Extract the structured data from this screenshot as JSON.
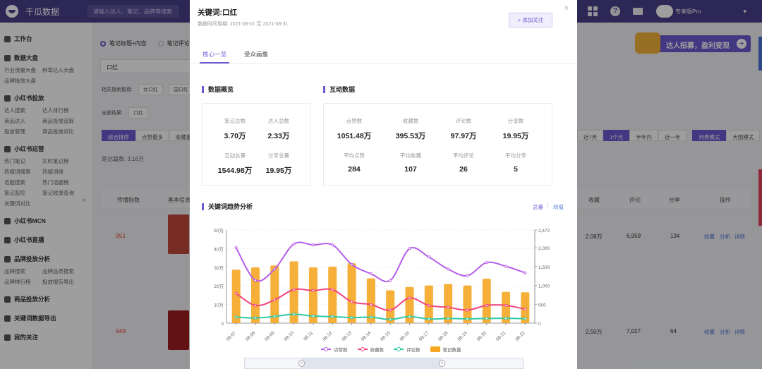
{
  "app": {
    "name": "千瓜数据",
    "search_placeholder": "请输入达人、笔记、品牌等搜索",
    "version": "专享版Pro"
  },
  "sidebar": {
    "sections": [
      {
        "title": "工作台",
        "rows": []
      },
      {
        "title": "数据大盘",
        "rows": [
          [
            "行业流量大盘",
            "种草达人大盘"
          ],
          [
            "品牌投放大盘",
            ""
          ]
        ]
      },
      {
        "title": "小红书投放",
        "rows": [
          [
            "达人搜索",
            "达人排行榜"
          ],
          [
            "商品达人",
            "商品投放追踪"
          ],
          [
            "投放管理",
            "商品投放对比"
          ]
        ]
      },
      {
        "title": "小红书运营",
        "rows": [
          [
            "热门笔记",
            "实时笔记榜"
          ],
          [
            "热搜词搜索",
            "热搜词榜"
          ],
          [
            "话题搜索",
            "热门话题榜"
          ],
          [
            "笔记监控",
            "笔记收录查询"
          ],
          [
            "关键词对比",
            ""
          ]
        ]
      },
      {
        "title": "小红书MCN",
        "rows": []
      },
      {
        "title": "小红书直播",
        "rows": []
      },
      {
        "title": "品牌投放分析",
        "rows": [
          [
            "品牌搜索",
            "品牌品类搜索"
          ],
          [
            "品牌排行榜",
            "投放报告导出"
          ]
        ]
      },
      {
        "title": "商品投放分析",
        "rows": []
      },
      {
        "title": "关键词数据导出",
        "rows": []
      },
      {
        "title": "我的关注",
        "rows": []
      }
    ]
  },
  "page": {
    "radio1": "笔记标题+内容",
    "radio2": "笔记评论",
    "keyword_value": "口红",
    "filter_label": "相关搜索推荐:",
    "chips": [
      "女口红",
      "国口红",
      "口红"
    ],
    "result_label": "全部结果:",
    "tabs": [
      "综合排序",
      "点赞最多",
      "收藏最多"
    ],
    "total": "笔记篇数:  3.16万",
    "range_tabs": [
      "近7天",
      "1个月",
      "半年内",
      "近一年"
    ],
    "mode_tabs": [
      "列表模式",
      "大图模式"
    ],
    "table_headers": [
      "传播指数",
      "基本信息",
      "收藏",
      "评论",
      "分享",
      "操作"
    ],
    "rows": [
      {
        "index": "951",
        "collect": "2.08万",
        "comment": "6,959",
        "share": "134"
      },
      {
        "index": "949",
        "collect": "2.50万",
        "comment": "7,027",
        "share": "64"
      }
    ],
    "actions": [
      "收藏",
      "分析",
      "详情"
    ],
    "banner": "达人招募，盈利变现"
  },
  "modal": {
    "title": "关键词:口红",
    "subtitle": "数据时间周期: 2021-08-01 至 2021-08-31",
    "follow_btn": "+ 添加关注",
    "close": "×",
    "tabs": [
      "核心一览",
      "受众画像"
    ],
    "overview_title": "数据概览",
    "overview": [
      {
        "label": "笔记总数",
        "value": "3.70万"
      },
      {
        "label": "达人总数",
        "value": "2.33万"
      },
      {
        "label": "互动总量",
        "value": "1544.98万"
      },
      {
        "label": "分享总量",
        "value": "19.95万"
      }
    ],
    "interaction_title": "互动数据",
    "interaction": [
      {
        "label": "点赞数",
        "value": "1051.48万"
      },
      {
        "label": "收藏数",
        "value": "395.53万"
      },
      {
        "label": "评论数",
        "value": "97.97万"
      },
      {
        "label": "分享数",
        "value": "19.95万"
      },
      {
        "label": "平均点赞",
        "value": "284"
      },
      {
        "label": "平均收藏",
        "value": "107"
      },
      {
        "label": "平均评论",
        "value": "26"
      },
      {
        "label": "平均分享",
        "value": "5"
      }
    ],
    "trend_title": "关键词趋势分析",
    "toggle": [
      "总量",
      "均值"
    ]
  },
  "colors": {
    "accent": "#6b5bd2",
    "likes": "#b65ee8",
    "collects": "#f0447f",
    "comments": "#2ec9a6",
    "notes": "#f5a623"
  },
  "chart_data": {
    "type": "line",
    "categories": [
      "08.07",
      "08.08",
      "08.09",
      "08.10",
      "08.11",
      "08.12",
      "08.13",
      "08.14",
      "08.15",
      "08.16",
      "08.17",
      "08.18",
      "08.19",
      "08.20",
      "08.21",
      "08.22"
    ],
    "y_left": {
      "ticks": [
        "0",
        "10万",
        "20万",
        "30万",
        "40万",
        "50万"
      ],
      "range": [
        0,
        500000
      ]
    },
    "y_right": {
      "ticks": [
        "0",
        "500",
        "1,000",
        "1,500",
        "2,000",
        "2,472"
      ],
      "range": [
        0,
        2472
      ]
    },
    "series": [
      {
        "name": "点赞数",
        "axis": "left",
        "values": [
          405000,
          230000,
          290000,
          425000,
          420000,
          420000,
          315000,
          265000,
          230000,
          400000,
          355000,
          290000,
          255000,
          325000,
          305000,
          270000
        ]
      },
      {
        "name": "收藏数",
        "axis": "left",
        "values": [
          160000,
          95000,
          125000,
          180000,
          175000,
          180000,
          115000,
          100000,
          70000,
          135000,
          95000,
          85000,
          70000,
          95000,
          95000,
          75000
        ]
      },
      {
        "name": "评论数",
        "axis": "left",
        "values": [
          32000,
          28000,
          36000,
          48000,
          38000,
          35000,
          30000,
          32000,
          20000,
          35000,
          22000,
          25000,
          23000,
          25000,
          26000,
          24000
        ]
      },
      {
        "name": "笔记数量",
        "type": "bar",
        "axis": "right",
        "values": [
          1420,
          1480,
          1530,
          1640,
          1480,
          1500,
          1590,
          1190,
          870,
          960,
          1000,
          1040,
          1000,
          1180,
          830,
          820
        ]
      }
    ]
  }
}
